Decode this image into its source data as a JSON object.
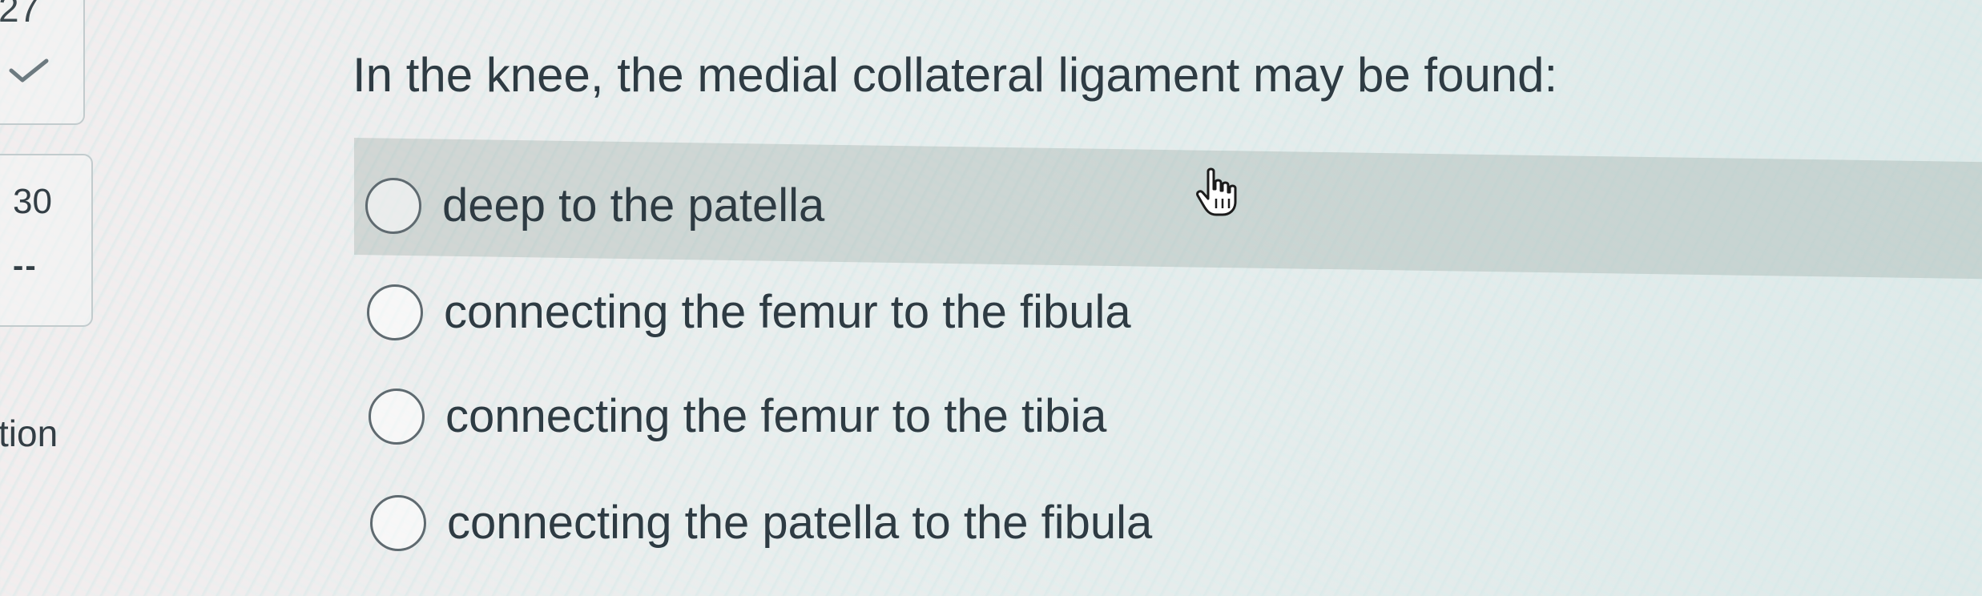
{
  "navigator": {
    "previous_question": {
      "number": "27",
      "status_icon": "check-icon"
    },
    "current_question": {
      "number": "30",
      "status": "--"
    },
    "partial_label": "tion"
  },
  "question": {
    "text": "In the knee, the medial collateral ligament may be found:"
  },
  "answers": [
    {
      "label": "deep to the patella",
      "selected": false,
      "hovered": true
    },
    {
      "label": "connecting the femur to the fibula",
      "selected": false
    },
    {
      "label": "connecting the femur to the tibia",
      "selected": false
    },
    {
      "label": "connecting the patella to the fibula",
      "selected": false
    }
  ],
  "cursor": {
    "icon": "hand-pointer-icon"
  },
  "colors": {
    "text": "#2e3b43",
    "check": "#6d7a80",
    "hover_row": "#a9b5b1",
    "radio_border": "#5f6a70"
  }
}
